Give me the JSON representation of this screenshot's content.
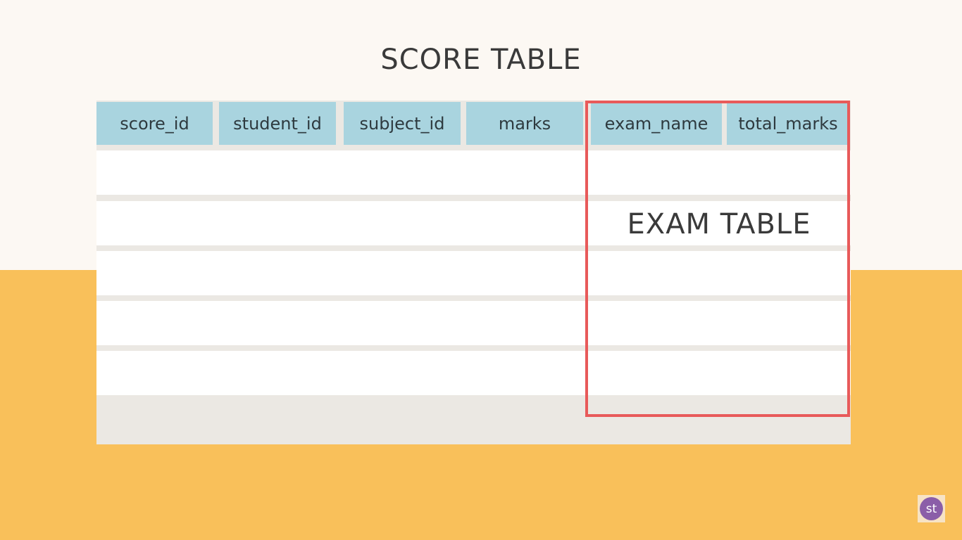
{
  "title": "SCORE TABLE",
  "columns": [
    "score_id",
    "student_id",
    "subject_id",
    "marks",
    "exam_name",
    "total_marks"
  ],
  "highlight": {
    "label": "EXAM TABLE",
    "color": "#e85a5a"
  },
  "logo": {
    "text": "st"
  },
  "colors": {
    "header": "#a9d4df",
    "background_top": "#fcf8f3",
    "background_bottom": "#f9c05a"
  }
}
